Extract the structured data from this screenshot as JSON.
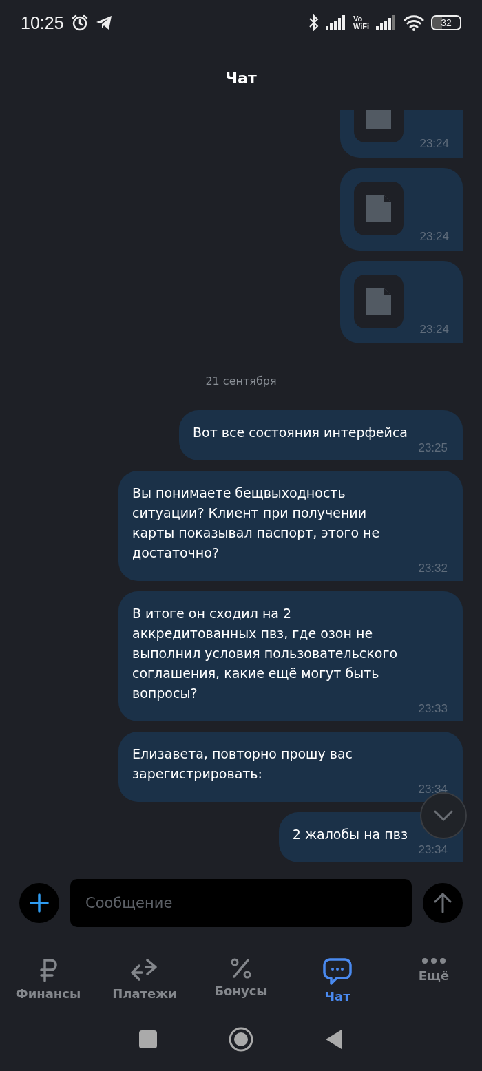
{
  "status_bar": {
    "time": "10:25",
    "network_label_lines": [
      "Vo",
      "WiFi"
    ],
    "battery": "32"
  },
  "header": {
    "title": "Чат"
  },
  "messages": [
    {
      "kind": "file",
      "time": "23:24"
    },
    {
      "kind": "file",
      "time": "23:24"
    },
    {
      "kind": "file",
      "time": "23:24"
    },
    {
      "kind": "date",
      "text": "21 сентября"
    },
    {
      "kind": "text",
      "text": "Вот все состояния интерфейса",
      "time": "23:25"
    },
    {
      "kind": "text",
      "text": "Вы понимаете бещвыходность ситуации? Клиент при получении карты показывал паспорт, этого не достаточно?",
      "time": "23:32"
    },
    {
      "kind": "text",
      "text": "В итоге он сходил на 2 аккредитованных пвз, где озон не выполнил условия пользовательского соглашения, какие ещё могут быть вопросы?",
      "time": "23:33"
    },
    {
      "kind": "text",
      "text": "Елизавета, повторно прошу вас зарегистрировать:",
      "time": "23:34"
    },
    {
      "kind": "text",
      "text": "2 жалобы на пвз",
      "time": "23:34"
    }
  ],
  "composer": {
    "placeholder": "Сообщение"
  },
  "tabs": [
    {
      "kind": "ruble",
      "label": "Финансы",
      "selected": false
    },
    {
      "kind": "transfer",
      "label": "Платежи",
      "selected": false
    },
    {
      "kind": "percent",
      "label": "Бонусы",
      "selected": false
    },
    {
      "kind": "chat",
      "label": "Чат",
      "selected": true
    },
    {
      "kind": "more",
      "label": "Ещё",
      "selected": false
    }
  ]
}
